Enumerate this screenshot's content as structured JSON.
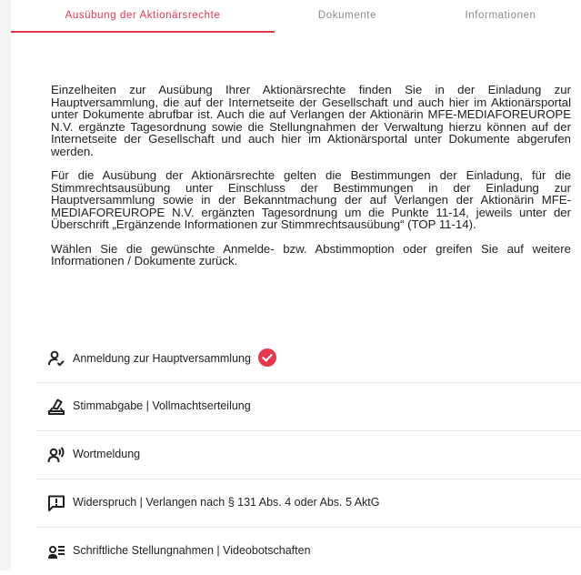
{
  "tabs": [
    {
      "label": "Ausübung der Aktionärsrechte",
      "active": true
    },
    {
      "label": "Dokumente",
      "active": false
    },
    {
      "label": "Informationen",
      "active": false
    }
  ],
  "accent_color": "#e5384f",
  "content": {
    "paragraphs": [
      "Einzelheiten zur Ausübung Ihrer Aktionärsrechte finden Sie in der Einladung zur Hauptversammlung, die auf der Internetseite der Gesellschaft und auch hier im Aktionärsportal unter Dokumente abrufbar ist. Auch die auf Verlangen der Aktionärin MFE-MEDIAFOREUROPE N.V. ergänzte Tagesordnung sowie die Stellungnahmen der Verwaltung hierzu können auf der Internetseite der Gesellschaft und auch hier im Aktionärsportal unter Dokumente abgerufen werden.",
      "Für die Ausübung der Aktionärsrechte gelten die Bestimmungen der Einladung, für die Stimmrechtsausübung unter Einschluss der Bestimmungen in der Einladung zur Hauptversammlung sowie in der Bekanntmachung der auf Verlangen der Aktionärin MFE-MEDIAFOREUROPE N.V. ergänzten Tagesordnung um die Punkte 11-14, jeweils unter der Überschrift „Ergänzende Informationen zur Stimmrechtsausübung“ (TOP 11-14).",
      "Wählen Sie die gewünschte Anmelde- bzw. Abstimmoption oder greifen Sie auf weitere Informationen / Dokumente zurück."
    ]
  },
  "options": [
    {
      "label": "Anmeldung zur Hauptversammlung",
      "icon": "user-check-icon",
      "status": "done"
    },
    {
      "label": "Stimmabgabe | Vollmachtserteilung",
      "icon": "ballot-box-icon"
    },
    {
      "label": "Wortmeldung",
      "icon": "speaking-user-icon"
    },
    {
      "label": "Widerspruch | Verlangen nach § 131 Abs. 4 oder Abs. 5 AktG",
      "icon": "alert-message-icon"
    },
    {
      "label": "Schriftliche Stellungnahmen | Videobotschaften",
      "icon": "user-list-icon"
    }
  ]
}
